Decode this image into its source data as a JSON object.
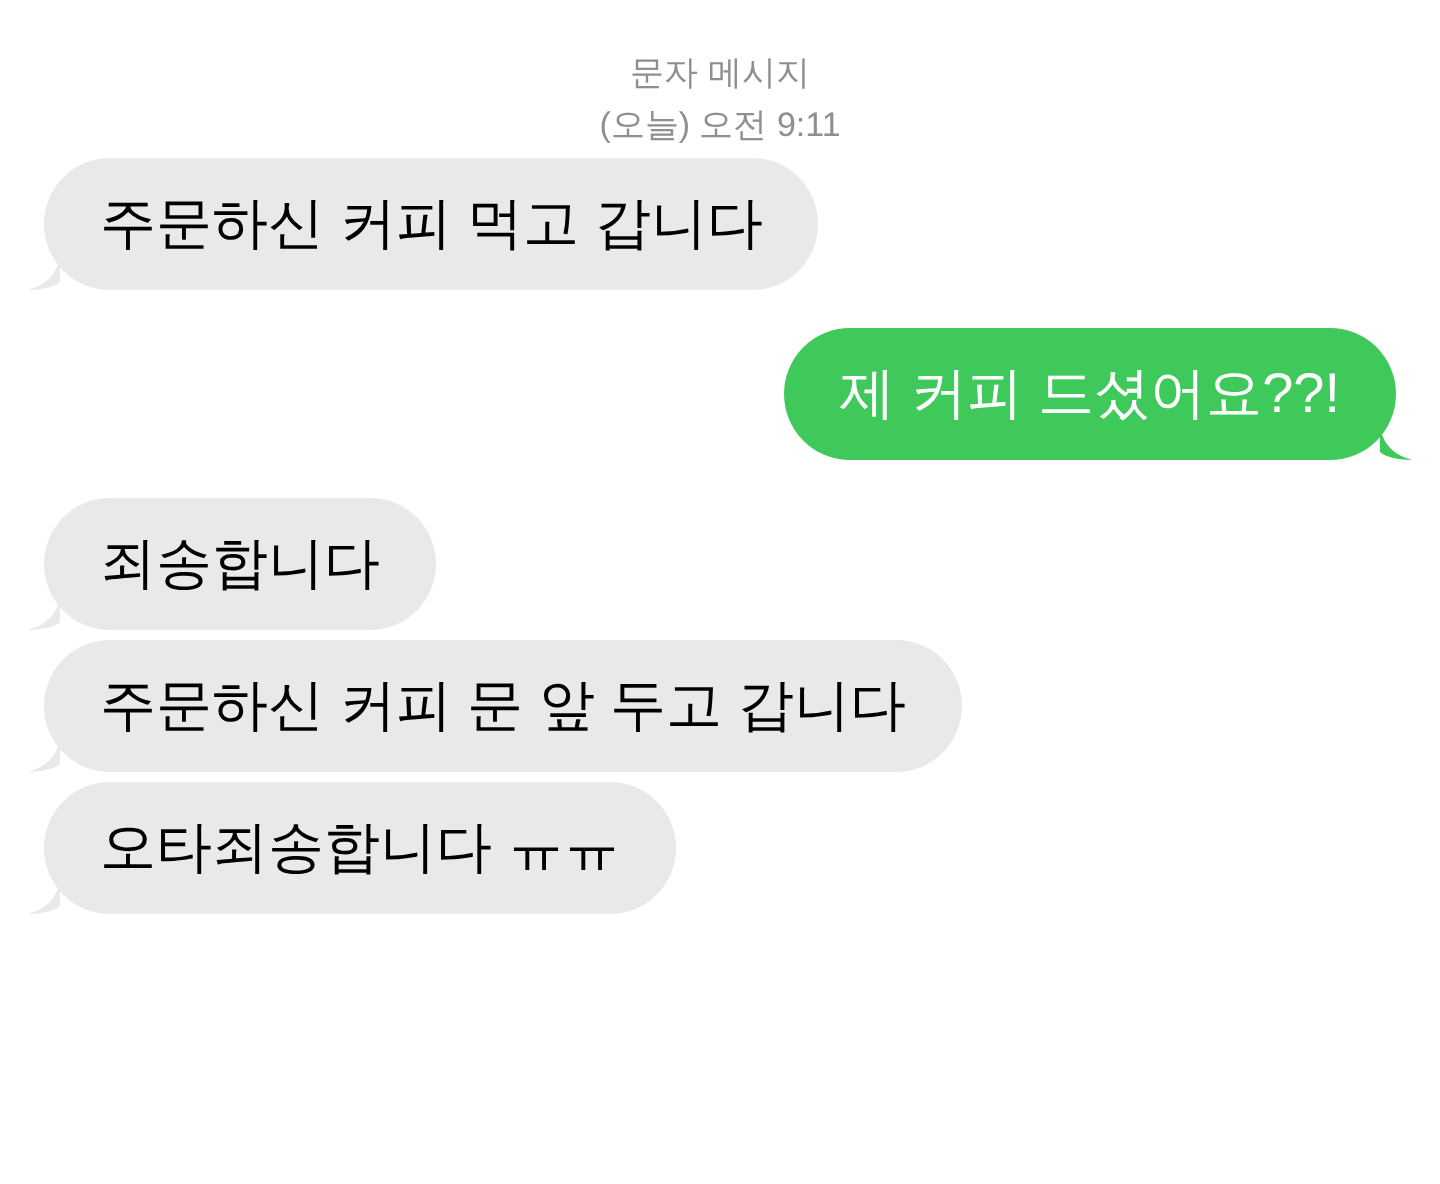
{
  "header": {
    "title": "문자 메시지",
    "timestamp": "(오늘) 오전 9:11"
  },
  "messages": [
    {
      "kind": "received",
      "text": "주문하신 커피 먹고 갑니다"
    },
    {
      "kind": "sent",
      "text": "제 커피 드셨어요??!"
    },
    {
      "kind": "received",
      "text": "죄송합니다"
    },
    {
      "kind": "received",
      "text": "주문하신 커피 문 앞 두고 갑니다"
    },
    {
      "kind": "received",
      "text": "오타죄송합니다 ㅠㅠ"
    }
  ]
}
